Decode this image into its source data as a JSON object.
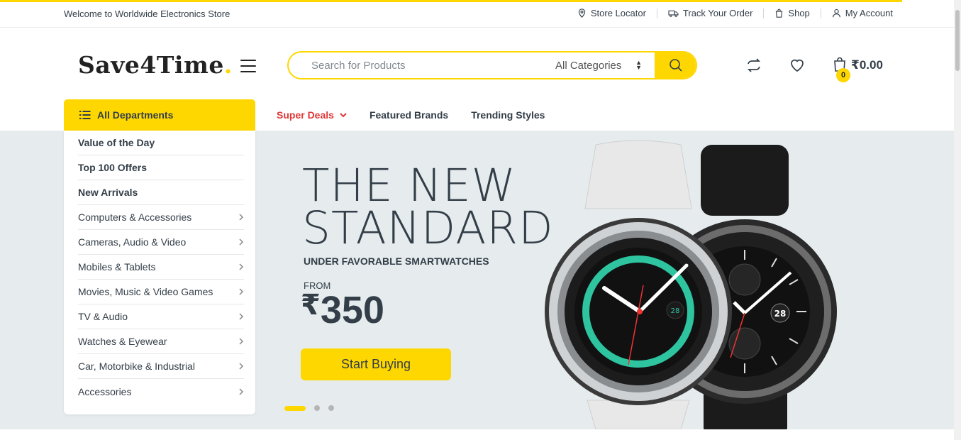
{
  "topbar": {
    "welcome": "Welcome to Worldwide Electronics Store",
    "links": [
      {
        "label": "Store Locator",
        "icon": "map-pin-icon"
      },
      {
        "label": "Track Your Order",
        "icon": "truck-icon"
      },
      {
        "label": "Shop",
        "icon": "shopping-bag-icon"
      },
      {
        "label": "My Account",
        "icon": "user-icon"
      }
    ]
  },
  "header": {
    "logo_text": "Save4Time",
    "logo_dot": ".",
    "search_placeholder": "Search for Products",
    "category_selected": "All Categories",
    "cart_count": "0",
    "cart_total": "₹0.00"
  },
  "departments": {
    "title": "All Departments",
    "items": [
      {
        "label": "Value of the Day",
        "bold": true,
        "has_sub": false
      },
      {
        "label": "Top 100 Offers",
        "bold": true,
        "has_sub": false
      },
      {
        "label": "New Arrivals",
        "bold": true,
        "has_sub": false
      },
      {
        "label": "Computers & Accessories",
        "bold": false,
        "has_sub": true
      },
      {
        "label": "Cameras, Audio & Video",
        "bold": false,
        "has_sub": true
      },
      {
        "label": "Mobiles & Tablets",
        "bold": false,
        "has_sub": true
      },
      {
        "label": "Movies, Music & Video Games",
        "bold": false,
        "has_sub": true
      },
      {
        "label": "TV & Audio",
        "bold": false,
        "has_sub": true
      },
      {
        "label": "Watches & Eyewear",
        "bold": false,
        "has_sub": true
      },
      {
        "label": "Car, Motorbike & Industrial",
        "bold": false,
        "has_sub": true
      },
      {
        "label": "Accessories",
        "bold": false,
        "has_sub": true
      }
    ]
  },
  "nav": {
    "items": [
      {
        "label": "Super Deals",
        "highlight": true
      },
      {
        "label": "Featured Brands",
        "highlight": false
      },
      {
        "label": "Trending Styles",
        "highlight": false
      }
    ]
  },
  "hero": {
    "title_line1": "THE NEW",
    "title_line2": "STANDARD",
    "subtitle": "UNDER FAVORABLE SMARTWATCHES",
    "from_label": "FROM",
    "currency": "₹",
    "price": "350",
    "cta": "Start Buying",
    "watch_date_front": "28",
    "watch_date_back": "28",
    "slides": 3,
    "active_slide": 1
  },
  "colors": {
    "accent": "#fed700",
    "text": "#333e48",
    "deal_red": "#df3737",
    "hero_bg": "#e6ecee"
  }
}
